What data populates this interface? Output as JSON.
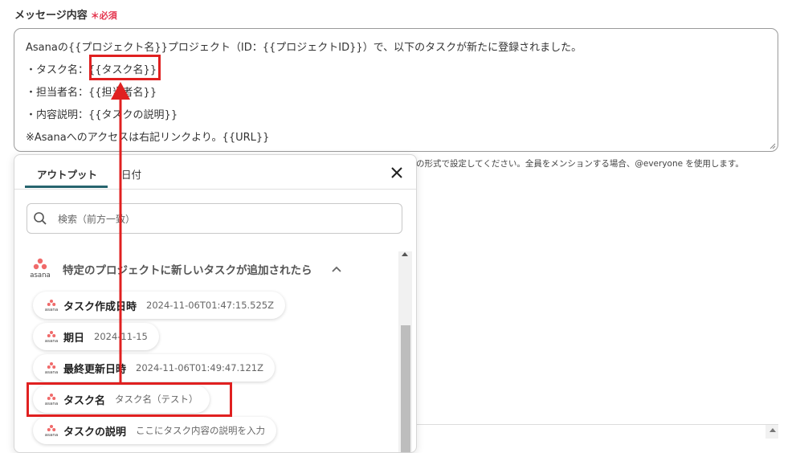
{
  "field": {
    "label": "メッセージ内容",
    "required": "＊必須"
  },
  "message": {
    "lines": [
      "Asanaの{{プロジェクト名}}プロジェクト（ID：{{プロジェクトID}}）で、以下のタスクが新たに登録されました。",
      "・タスク名：{{タスク名}}",
      "・担当者名：{{担当者名}}",
      "・内容説明：{{タスクの説明}}",
      "※Asanaへのアクセスは右記リンクより。{{URL}}"
    ]
  },
  "hint": "の形式で設定してください。全員をメンションする場合、@everyone を使用します。",
  "popup": {
    "tabs": [
      "アウトプット",
      "日付"
    ],
    "search_placeholder": "検索（前方一致）",
    "section_title": "特定のプロジェクトに新しいタスクが追加されたら",
    "logo_text": "asana",
    "items": [
      {
        "name": "タスク作成日時",
        "value": "2024-11-06T01:47:15.525Z"
      },
      {
        "name": "期日",
        "value": "2024-11-15"
      },
      {
        "name": "最終更新日時",
        "value": "2024-11-06T01:49:47.121Z"
      },
      {
        "name": "タスク名",
        "value": "タスク名（テスト）"
      },
      {
        "name": "タスクの説明",
        "value": "ここにタスク内容の説明を入力"
      }
    ]
  },
  "colors": {
    "accent": "#26646e",
    "required": "#e4344d",
    "highlight": "#e02020",
    "asana_logo": "#f06a6a"
  }
}
